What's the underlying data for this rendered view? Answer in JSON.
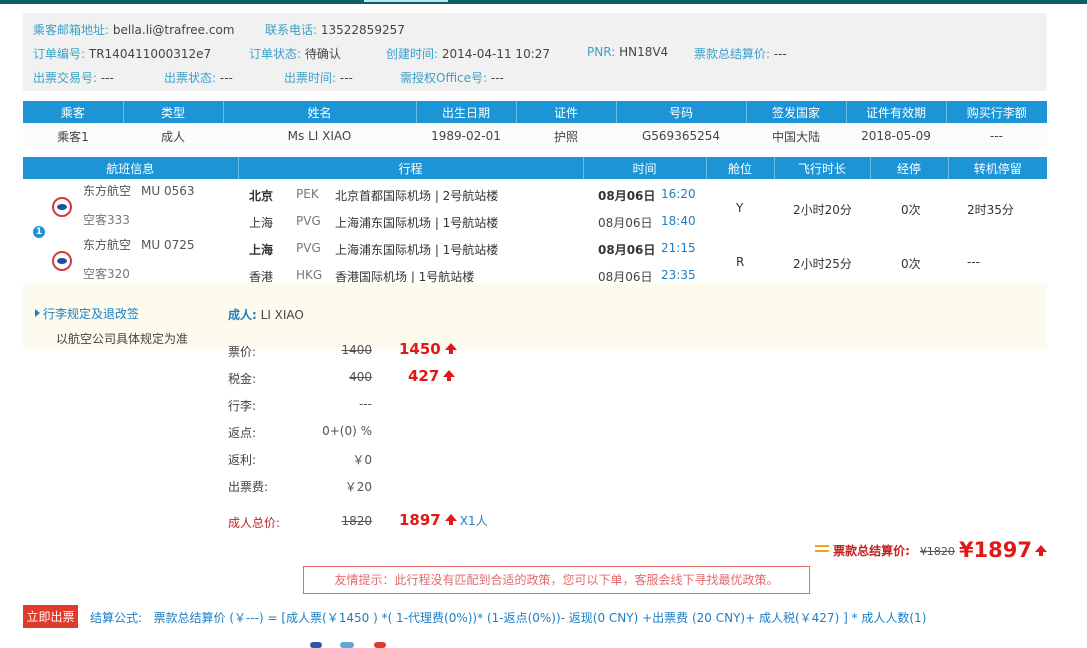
{
  "info": {
    "email_label": "乘客邮箱地址:",
    "email": "bella.li@trafree.com",
    "phone_label": "联系电话:",
    "phone": "13522859257",
    "order_no_label": "订单编号:",
    "order_no": "TR140411000312e7",
    "status_label": "订单状态:",
    "status": "待确认",
    "created_label": "创建时间:",
    "created": "2014-04-11 10:27",
    "pnr_label": "PNR:",
    "pnr": "HN18V4",
    "total_label": "票款总结算价:",
    "total": "---",
    "trade_no_label": "出票交易号:",
    "trade_no": "---",
    "ticket_status_label": "出票状态:",
    "ticket_status": "---",
    "ticket_time_label": "出票时间:",
    "ticket_time": "---",
    "office_label": "需授权Office号:",
    "office": "---"
  },
  "passengers": {
    "headers": [
      "乘客",
      "类型",
      "姓名",
      "出生日期",
      "证件",
      "号码",
      "签发国家",
      "证件有效期",
      "购买行李额"
    ],
    "rows": [
      [
        "乘客1",
        "成人",
        "Ms LI XIAO",
        "1989-02-01",
        "护照",
        "G569365254",
        "中国大陆",
        "2018-05-09",
        "---"
      ]
    ]
  },
  "flights": {
    "headers": [
      "航班信息",
      "行程",
      "时间",
      "舱位",
      "飞行时长",
      "经停",
      "转机停留"
    ],
    "badge": "1",
    "segments": [
      {
        "airline": "东方航空",
        "flight_no": "MU  0563",
        "aircraft": "空客333",
        "dep_city": "北京",
        "dep_code": "PEK",
        "dep_airport": "北京首都国际机场 | 2号航站楼",
        "arr_city": "上海",
        "arr_code": "PVG",
        "arr_airport": "上海浦东国际机场 | 1号航站楼",
        "dep_date": "08月06日",
        "dep_time": "16:20",
        "arr_date": "08月06日",
        "arr_time": "18:40",
        "cabin": "Y",
        "duration": "2小时20分",
        "stops": "0次",
        "transfer": "2时35分"
      },
      {
        "airline": "东方航空",
        "flight_no": "MU  0725",
        "aircraft": "空客320",
        "dep_city": "上海",
        "dep_code": "PVG",
        "dep_airport": "上海浦东国际机场 | 1号航站楼",
        "arr_city": "香港",
        "arr_code": "HKG",
        "arr_airport": "香港国际机场 | 1号航站楼",
        "dep_date": "08月06日",
        "dep_time": "21:15",
        "arr_date": "08月06日",
        "arr_time": "23:35",
        "cabin": "R",
        "duration": "2小时25分",
        "stops": "0次",
        "transfer": "---"
      }
    ]
  },
  "fare": {
    "rules_title": "行李规定及退改签",
    "rules_text": "以航空公司具体规定为准",
    "passenger_type": "成人:",
    "passenger_name": " LI XIAO",
    "rows": [
      {
        "label": "票价:",
        "old": "1400",
        "new": "1450"
      },
      {
        "label": "税金:",
        "old": "400",
        "new": "427"
      },
      {
        "label": "行李:",
        "old": "---"
      },
      {
        "label": "返点:",
        "old": "0+(0) %"
      },
      {
        "label": "返利:",
        "old": "￥0"
      },
      {
        "label": "出票费:",
        "old": "￥20"
      }
    ],
    "adult_total_label": "成人总价:",
    "adult_total_old": "1820",
    "adult_total_new": "1897",
    "adult_count": "X1人"
  },
  "total": {
    "label": "票款总结算价:",
    "old": "¥1820",
    "new": "¥1897"
  },
  "tip": "友情提示：此行程没有匹配到合适的政策，您可以下单，客服会线下寻找最优政策。",
  "bottom": {
    "issue_button": "立即出票",
    "formula_label": "结算公式:",
    "formula": "票款总结算价 (￥---) = [成人票(￥1450 ) *( 1-代理费(0%))* (1-返点(0%))- 返现(0 CNY) +出票费 (20 CNY)+ 成人税(￥427) ] * 成人人数(1)"
  },
  "colors": {
    "header_blue": "#1d94d6",
    "price_red": "#e01818",
    "label_blue": "#3aa1c7",
    "issue_button": "#e03a2a"
  }
}
